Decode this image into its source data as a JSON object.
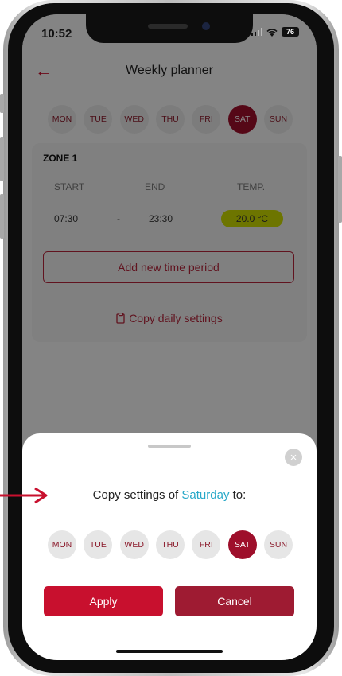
{
  "status_bar": {
    "time": "10:52",
    "battery": "76"
  },
  "header": {
    "title": "Weekly planner",
    "back_icon": "arrow-left-icon"
  },
  "days": {
    "items": [
      "MON",
      "TUE",
      "WED",
      "THU",
      "FRI",
      "SAT",
      "SUN"
    ],
    "selected": "SAT"
  },
  "zone": {
    "title": "ZONE 1",
    "col_start": "START",
    "col_end": "END",
    "col_temp": "TEMP.",
    "start": "07:30",
    "separator": "-",
    "end": "23:30",
    "temp": "20.0 °C",
    "add_label": "Add new time period",
    "copy_label": "Copy daily settings",
    "copy_icon": "clipboard-icon"
  },
  "sheet": {
    "text_before": "Copy settings of ",
    "highlight": "Saturday",
    "text_after": " to:",
    "close_icon": "close-icon",
    "apply_label": "Apply",
    "cancel_label": "Cancel"
  },
  "colors": {
    "accent": "#c8102e",
    "selected_day": "#9e0f2b",
    "highlight": "#27a8c8",
    "temp_pill": "#c9d800"
  }
}
